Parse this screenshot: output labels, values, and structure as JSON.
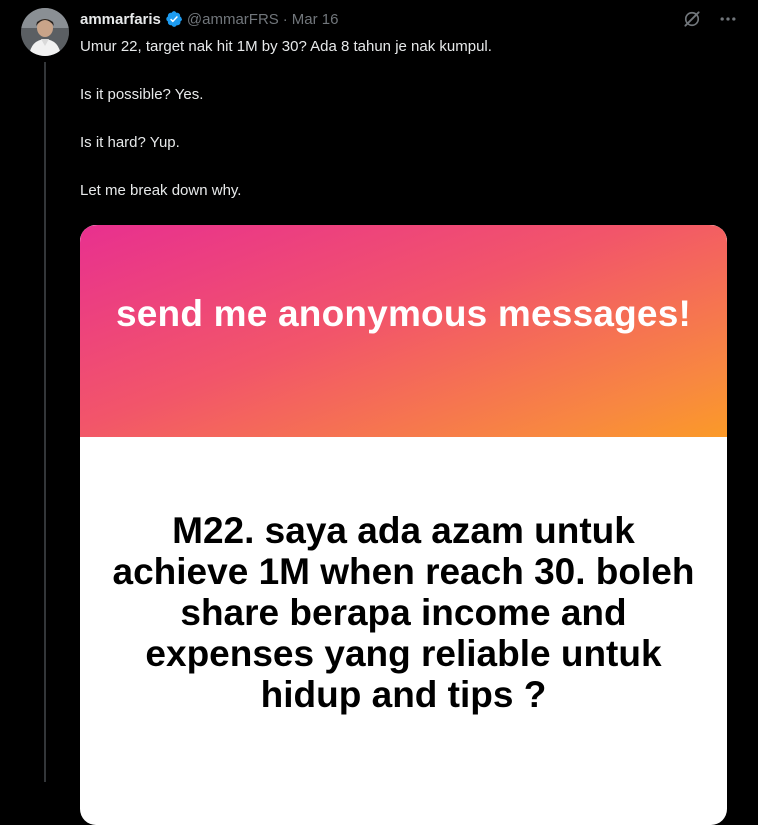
{
  "author": {
    "name": "ammarfaris",
    "handle": "@ammarFRS",
    "separator": "·",
    "date": "Mar 16",
    "verified_color": "#1d9bf0"
  },
  "icons": {
    "verified": "verified-badge-icon",
    "grok": "grok-icon",
    "more": "more-icon"
  },
  "tweet": {
    "lines": [
      "Umur 22, target nak hit 1M by 30? Ada 8 tahun je nak kumpul.",
      "Is it possible? Yes.",
      "Is it hard? Yup.",
      "Let me break down why."
    ]
  },
  "media": {
    "headline": "send me anonymous messages!",
    "question": "M22. saya ada azam untuk achieve 1M when reach 30. boleh share berapa income and expenses yang reliable untuk hidup and tips ?",
    "gradient_colors": [
      "#e8308f",
      "#f2556a",
      "#f88840",
      "#fb9a28"
    ]
  },
  "colors": {
    "background": "#000000",
    "text": "#e7e9ea",
    "muted": "#71767b"
  }
}
